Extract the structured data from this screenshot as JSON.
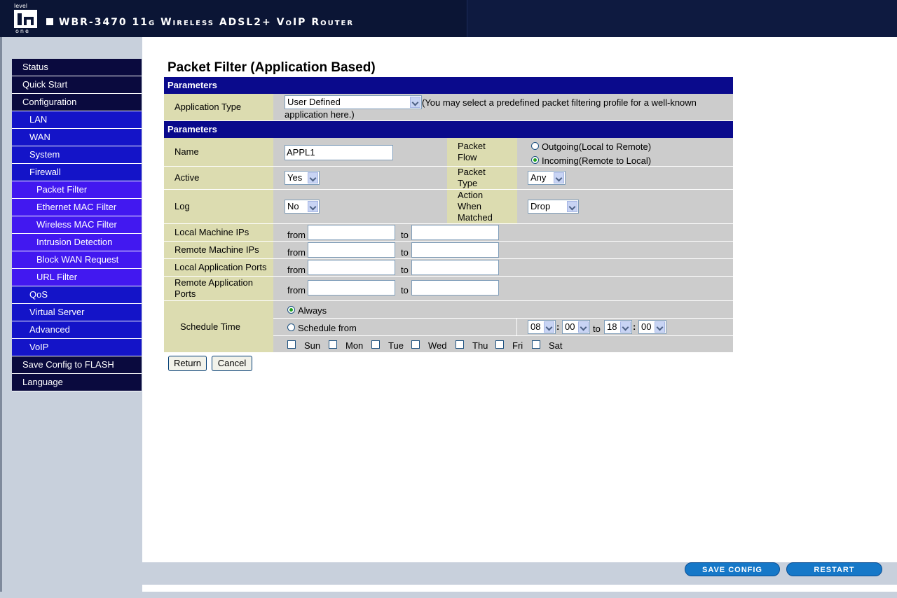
{
  "header": {
    "logo_top": "level",
    "logo_bottom": "one",
    "title": "WBR-3470 11g Wireless ADSL2+ VoIP Router"
  },
  "nav": [
    {
      "label": "Status",
      "level": 1
    },
    {
      "label": "Quick Start",
      "level": 1
    },
    {
      "label": "Configuration",
      "level": 1
    },
    {
      "label": "LAN",
      "level": 2
    },
    {
      "label": "WAN",
      "level": 2
    },
    {
      "label": "System",
      "level": 2
    },
    {
      "label": "Firewall",
      "level": 2
    },
    {
      "label": "Packet Filter",
      "level": 3
    },
    {
      "label": "Ethernet MAC Filter",
      "level": 3
    },
    {
      "label": "Wireless MAC Filter",
      "level": 3
    },
    {
      "label": "Intrusion Detection",
      "level": 3
    },
    {
      "label": "Block WAN Request",
      "level": 3
    },
    {
      "label": "URL Filter",
      "level": 3
    },
    {
      "label": "QoS",
      "level": 2
    },
    {
      "label": "Virtual Server",
      "level": 2
    },
    {
      "label": "Advanced",
      "level": 2
    },
    {
      "label": "VoIP",
      "level": 2
    },
    {
      "label": "Save Config to FLASH",
      "level": 1
    },
    {
      "label": "Language",
      "level": 1
    }
  ],
  "page": {
    "title": "Packet Filter (Application Based)",
    "section1": "Parameters",
    "section2": "Parameters",
    "app_type": {
      "label": "Application Type",
      "value": "User Defined",
      "hint_line1": "(You may select a predefined packet filtering profile for a well-known",
      "hint_line2": "application here.)"
    },
    "name": {
      "label": "Name",
      "value": "APPL1"
    },
    "packet_flow": {
      "label_line1": "Packet",
      "label_line2": "Flow",
      "opt_outgoing": "Outgoing(Local to Remote)",
      "opt_incoming": "Incoming(Remote to Local)"
    },
    "active": {
      "label": "Active",
      "value": "Yes"
    },
    "packet_type": {
      "label_line1": "Packet",
      "label_line2": "Type",
      "value": "Any"
    },
    "log": {
      "label": "Log",
      "value": "No"
    },
    "action": {
      "label_line1": "Action",
      "label_line2": "When",
      "label_line3": "Matched",
      "value": "Drop"
    },
    "local_ips": {
      "label": "Local Machine IPs"
    },
    "remote_ips": {
      "label": "Remote Machine IPs"
    },
    "local_ports": {
      "label": "Local Application Ports"
    },
    "remote_ports": {
      "label_line1": "Remote Application",
      "label_line2": "Ports"
    },
    "from_label": "from",
    "to_label": "to",
    "schedule": {
      "label": "Schedule Time",
      "always": "Always",
      "schedule_from": "Schedule from",
      "from_hour": "08",
      "from_min": "00",
      "to_hour": "18",
      "to_min": "00",
      "colon": ":",
      "to_word": "to",
      "days": [
        "Sun",
        "Mon",
        "Tue",
        "Wed",
        "Thu",
        "Fri",
        "Sat"
      ]
    },
    "buttons": {
      "return": "Return",
      "cancel": "Cancel"
    }
  },
  "footer": {
    "save": "SAVE CONFIG",
    "restart": "RESTART"
  }
}
